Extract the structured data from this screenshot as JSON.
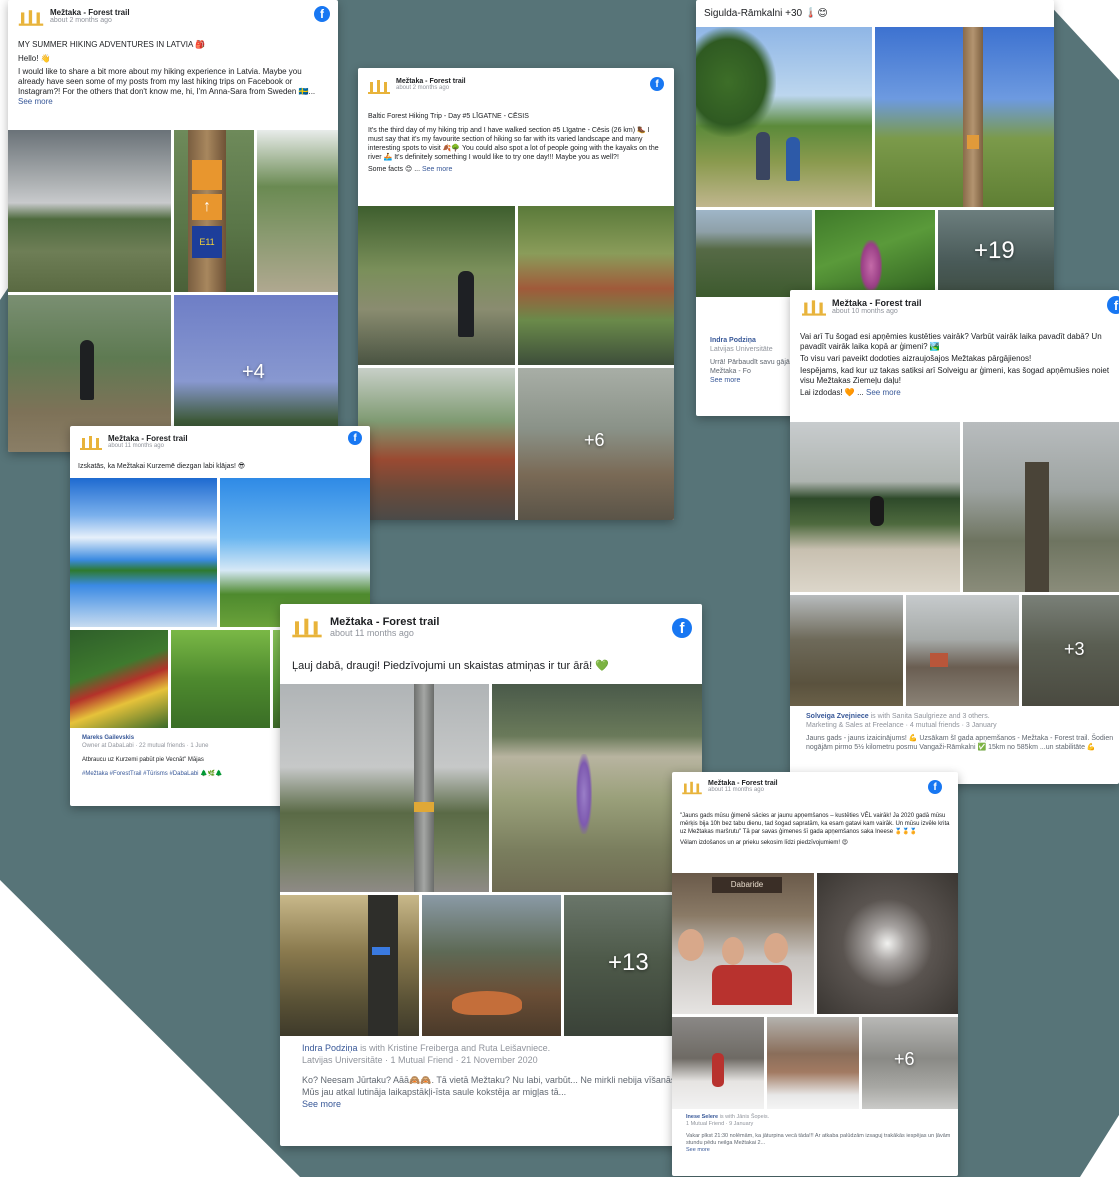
{
  "page_name": "Mežtaka - Forest trail",
  "cards": {
    "c1": {
      "page": "Mežtaka - Forest trail",
      "time": "about 2 months ago",
      "title": "MY SUMMER HIKING ADVENTURES IN LATVIA 🎒",
      "hello": "Hello! 👋",
      "body": "I would like to share a bit more about my hiking experience in Latvia. Maybe you already have seen some of my posts from my last hiking trips on Facebook or Instagram?! For the others that don't know me, hi, I'm Anna-Sara from Sweden 🇸🇪...",
      "see_more": "See more",
      "more_count": "+4",
      "sign_text": "E11"
    },
    "c2": {
      "page": "Mežtaka - Forest trail",
      "time": "about 2 months ago",
      "title": "Baltic Forest Hiking Trip - Day #5 LĪGATNE - CĒSIS",
      "body": "It's the third day of my hiking trip and I have walked section #5 Līgatne - Cēsis (26 km) 🥾 I must say that it's my favourite section of hiking so far with its varied landscape and many interesting spots to visit 🍂🌳 You could also spot a lot of people going with the kayaks on the river 🚣 It's definitely something I would like to try one day!!! Maybe you as well?!",
      "facts": "Some facts 😊 ...",
      "see_more": "See more",
      "more_count": "+6"
    },
    "c3": {
      "top_text": "Sigulda-Rāmkalni +30 🌡️😊",
      "more_count": "+19",
      "foot_name": "Indra Podziņa",
      "foot_sub": "Latvijas Universitāte",
      "foot_text": "Urrā! Pārbaudīt savu gājām Mežtaka - Fo",
      "see_more": "See more"
    },
    "c4": {
      "page": "Mežtaka - Forest trail",
      "time": "about 10 months ago",
      "line1": "Vai arī Tu šogad esi apņēmies kustēties vairāk? Varbūt vairāk laika pavadīt dabā? Un pavadīt vairāk laika kopā ar ģimeni? 🏞️",
      "line2": "To visu vari paveikt dodoties aizraujošajos Mežtakas pārgājienos!",
      "line3": "Iespējams, kad kur uz takas satiksi arī Solveigu ar ģimeni, kas šogad apņēmušies noiet visu Mežtakas Ziemeļu daļu!",
      "line4": "Lai izdodas! 🧡 ...",
      "see_more": "See more",
      "more_count": "+3",
      "foot_name": "Solveiga Zvejniece",
      "foot_with": "is with Sanita Saulgrieze and 3 others.",
      "foot_sub": "Marketing & Sales at Freelance · 4 mutual friends · 3 January",
      "foot_text": "Jauns gads - jauns izaicinājums! 💪 Uzsākam šī gada apņemšanos - Mežtaka - Forest trail. Šodien nogājām pirmo 5½ kilometru posmu Vangaži-Rāmkalni ✅ 15km no 585km ...un stabilitāte 💪"
    },
    "c5": {
      "page": "Mežtaka - Forest trail",
      "time": "about 11 months ago",
      "line": "Izskatās, ka Mežtakai Kurzemē diezgan labi klājas! 😎",
      "foot_name": "Mareks Gailevskis",
      "foot_sub": "Owner at DabaLabi · 22 mutual friends · 1 June",
      "foot_text": "Atbraucu uz Kurzemi pabūt pie Vecnāt\" Mājas",
      "foot_tags": "#Mežtaka #ForestTrail #Tūrisms #DabaLabi 🌲🌿🌲"
    },
    "c6": {
      "page": "Mežtaka - Forest trail",
      "time": "about 11 months ago",
      "line": "Ļauj dabā, draugi! Piedzīvojumi un skaistas atmiņas ir tur ārā! 💚",
      "more_count": "+13",
      "foot_name": "Indra Podziņa",
      "foot_with": "is with Kristine Freiberga and Ruta Leišavniece.",
      "foot_sub": "Latvijas Universitāte · 1 Mutual Friend · 21 November 2020",
      "foot_text": "Ko? Neesam Jūrtaku? Aāā🙈🙈. Tā vietā Mežtaku? Nu labi, varbūt... Ne mirkli nebija vīšanās! Mūs jau atkal lutināja laikapstākļi-īsta saule kokstēja ar migļas tā...",
      "see_more": "See more"
    },
    "c7": {
      "page": "Mežtaka - Forest trail",
      "time": "about 11 months ago",
      "body": "\"Jauns gads mūsu ģimenē sācies ar jaunu apņemšanos – kustēties VĒL vairāk! Ja 2020 gadā mūsu mērķis bija 10h bez tabu dienu, tad šogad sapratām, ka esam gatavi kam vairāk. Un mūsu izvēle krita uz Mežtakas maršrutu\" Tā par savas ģimenes šī gada apņemšanos saka Ineese 🏅🏅🏅",
      "line2": "Vēlam izdošanos un ar prieku sekosim līdzi piedzīvojumiem! 😍",
      "more_count": "+6",
      "foot_name": "Inese Selere",
      "foot_with": "is with Jānis Šopeis.",
      "foot_sub": "1 Mutual Friend · 9 January",
      "foot_text": "Vakar plkst 21:30 nolēmām, ka jāturpina vecā tāda!!! Ar atkaba palūdzām izsaguj trakākās iespējas un ļāvām stundu pēdu neilga Mežtakai 2...",
      "see_more": "See more",
      "sign_text": "Dabaride"
    }
  },
  "colors": {
    "background_shape": "#577478",
    "facebook_blue": "#1877f2",
    "link_blue": "#385898",
    "logo_gold": "#e8b33a"
  }
}
